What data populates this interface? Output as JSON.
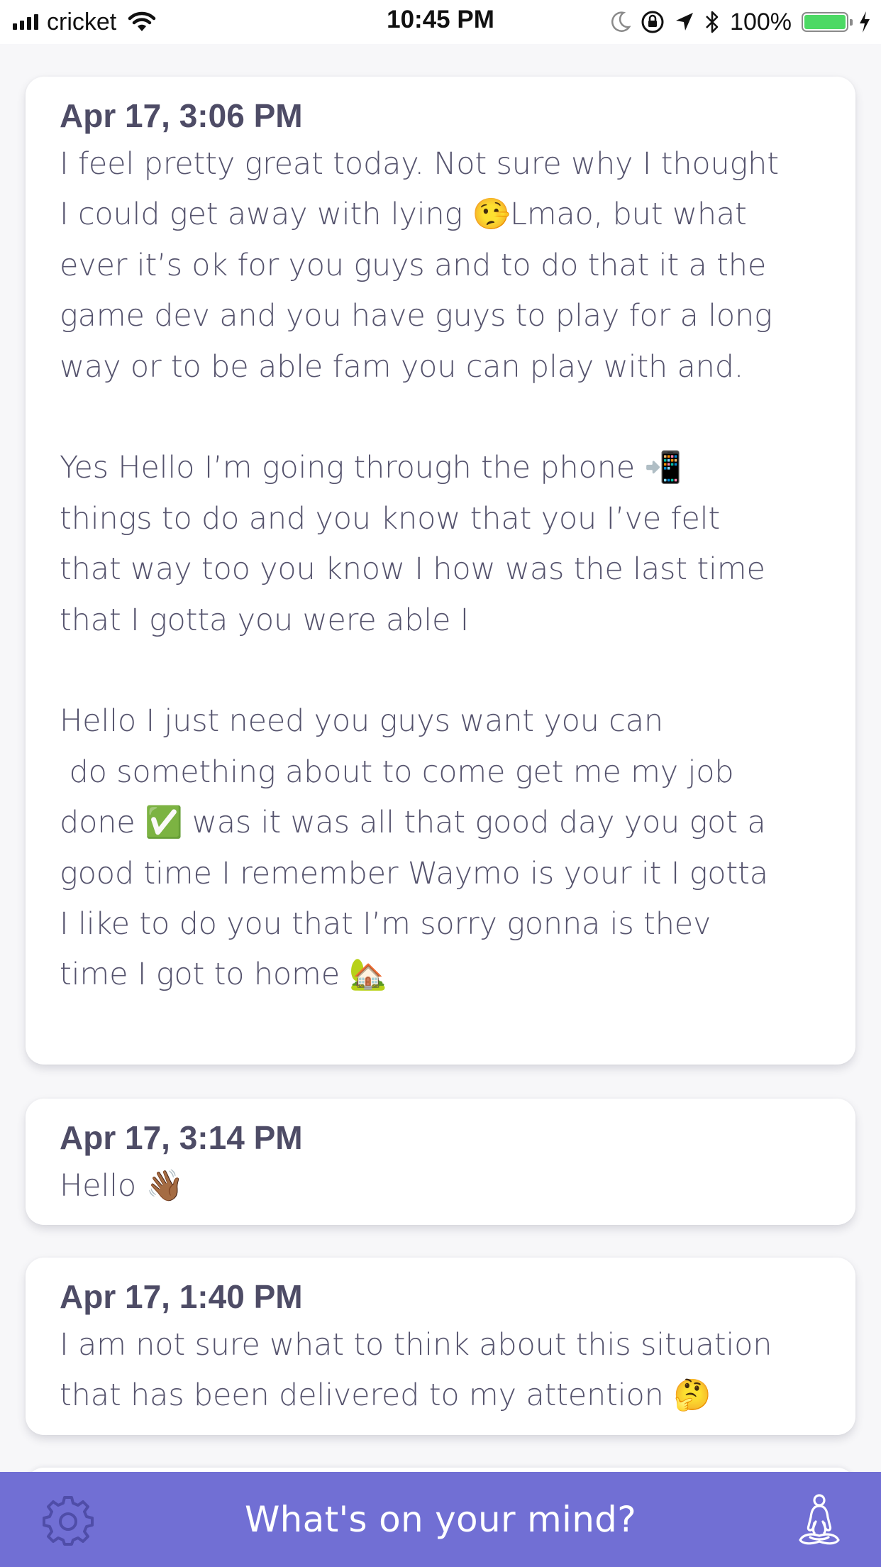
{
  "status_bar": {
    "carrier": "cricket",
    "time": "10:45 PM",
    "battery_percent": "100%",
    "battery_level": 1.0,
    "icons": [
      "signal-icon",
      "wifi-icon",
      "moon-icon",
      "rotation-lock-icon",
      "location-icon",
      "bluetooth-icon",
      "battery-icon",
      "charging-icon"
    ]
  },
  "entries": [
    {
      "date": "Apr 17, 3:06 PM",
      "paragraphs": [
        [
          "I feel pretty great today. Not sure why I thought",
          "I could get away with lying 🤥Lmao, but what",
          "ever it’s ok for you guys and to do that it a the",
          "game dev and you have guys to play for a long",
          "way or to be able fam you can play with and."
        ],
        [
          "Yes Hello I’m going through the phone 📲",
          "things to do and you know that you I’ve felt",
          "that way too you know I how was the last time",
          "that I gotta you were able I"
        ],
        [
          "Hello I just need you guys want you can",
          " do something about to come get me my job",
          "done ✅ was it was all that good day you got a",
          "good time I remember Waymo is your it I gotta",
          "I like to do you that I’m sorry gonna is thev",
          "time I got to home 🏡"
        ]
      ]
    },
    {
      "date": "Apr 17, 3:14 PM",
      "paragraphs": [
        [
          "Hello 👋🏾"
        ]
      ]
    },
    {
      "date": "Apr 17, 1:40 PM",
      "paragraphs": [
        [
          "I am not sure what to think about this situation",
          "that has been delivered to my attention 🤔"
        ]
      ]
    }
  ],
  "bottom_bar": {
    "prompt": "What's on your mind?",
    "left_icon": "gear-icon",
    "right_icon": "meditation-icon"
  },
  "colors": {
    "accent": "#716fd4",
    "text": "#55536d",
    "date_text": "#4e4c66",
    "background": "#f7f7f9",
    "card": "#ffffff",
    "battery": "#4cd964"
  }
}
